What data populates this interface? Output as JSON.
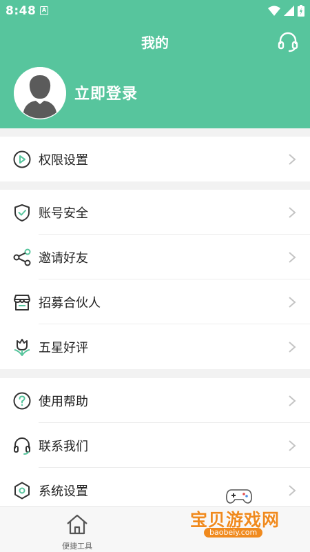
{
  "status_bar": {
    "time": "8:48",
    "notification_letter": "A"
  },
  "header": {
    "title": "我的",
    "support_icon": "headset-icon",
    "login_label": "立即登录",
    "avatar_icon": "user-avatar-icon"
  },
  "sections": [
    {
      "items": [
        {
          "label": "权限设置",
          "icon": "play-circle-icon"
        }
      ]
    },
    {
      "items": [
        {
          "label": "账号安全",
          "icon": "shield-check-icon"
        },
        {
          "label": "邀请好友",
          "icon": "share-icon"
        },
        {
          "label": "招募合伙人",
          "icon": "store-icon"
        },
        {
          "label": "五星好评",
          "icon": "tulip-icon"
        }
      ]
    },
    {
      "items": [
        {
          "label": "使用帮助",
          "icon": "question-circle-icon"
        },
        {
          "label": "联系我们",
          "icon": "headset-icon"
        },
        {
          "label": "系统设置",
          "icon": "settings-hexagon-icon"
        }
      ]
    }
  ],
  "bottom_nav": {
    "tabs": [
      {
        "label": "便捷工具",
        "icon": "home-icon"
      }
    ]
  },
  "watermark": {
    "text": "宝贝游戏网",
    "url": "baobeiy.com",
    "icon": "gamepad-icon"
  },
  "colors": {
    "brand": "#57c59d",
    "background": "#f2f2f2",
    "text": "#222222",
    "chevron": "#c4c4c4",
    "watermark": "#f08a1e"
  }
}
